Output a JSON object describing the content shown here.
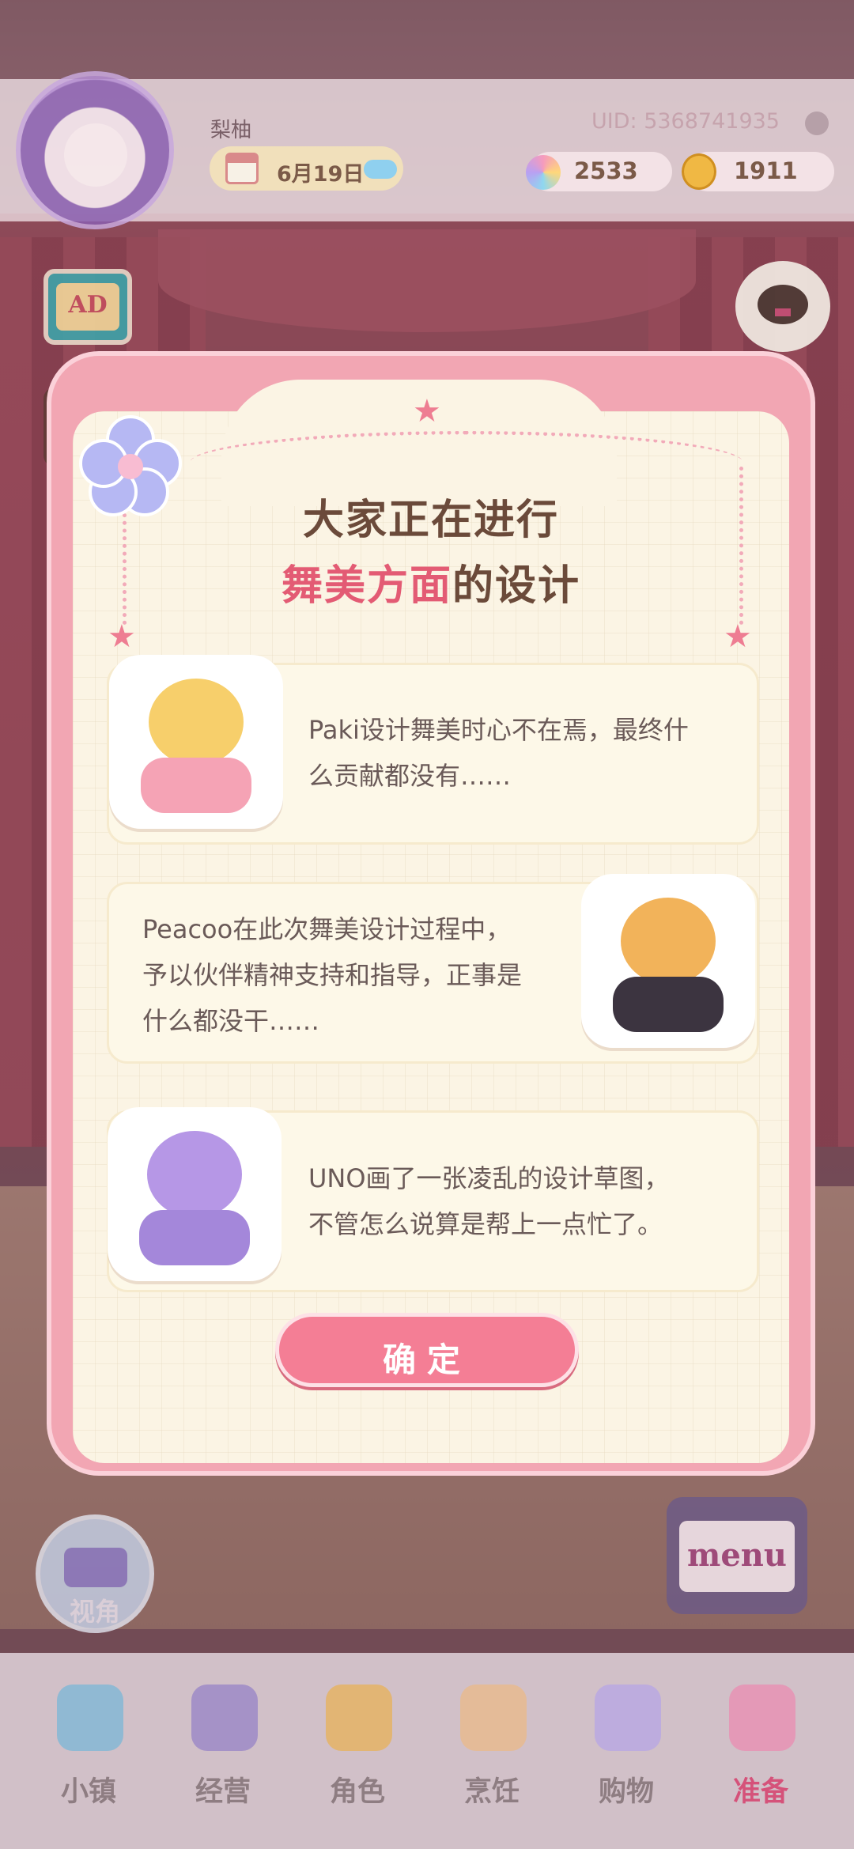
{
  "header": {
    "username": "梨柚",
    "date": "6月19日",
    "uid": "UID: 5368741935",
    "gems": "2533",
    "coins": "1911"
  },
  "widgets": {
    "ad_label": "AD",
    "camera_label": "视角",
    "menu_label": "menu"
  },
  "dialog": {
    "title_line1": "大家正在进行",
    "title_highlight": "舞美方面",
    "title_suffix": "的设计",
    "events": [
      {
        "character": "Paki",
        "text_line1": "Paki设计舞美时心不在焉，最终什",
        "text_line2": "么贡献都没有……"
      },
      {
        "character": "Peacoo",
        "text_line1": "Peacoo在此次舞美设计过程中，",
        "text_line2": "予以伙伴精神支持和指导，正事是",
        "text_line3": "什么都没干……"
      },
      {
        "character": "UNO",
        "text_line1": "UNO画了一张凌乱的设计草图，",
        "text_line2": "不管怎么说算是帮上一点忙了。"
      }
    ],
    "confirm_label": "确定"
  },
  "bottom_nav": {
    "items": [
      {
        "label": "小镇",
        "icon": "map-icon"
      },
      {
        "label": "经营",
        "icon": "shop-bag-icon"
      },
      {
        "label": "角色",
        "icon": "character-icon"
      },
      {
        "label": "烹饪",
        "icon": "sandwich-icon"
      },
      {
        "label": "购物",
        "icon": "shopping-bag-icon"
      },
      {
        "label": "准备",
        "icon": "dressup-icon"
      }
    ],
    "active_index": 5
  },
  "colors": {
    "accent_pink": "#e35b74",
    "button_pink": "#f47e95",
    "title_brown": "#6b4a3a",
    "dialog_border": "#f2a6b3",
    "dialog_bg": "#fbf4e4"
  }
}
